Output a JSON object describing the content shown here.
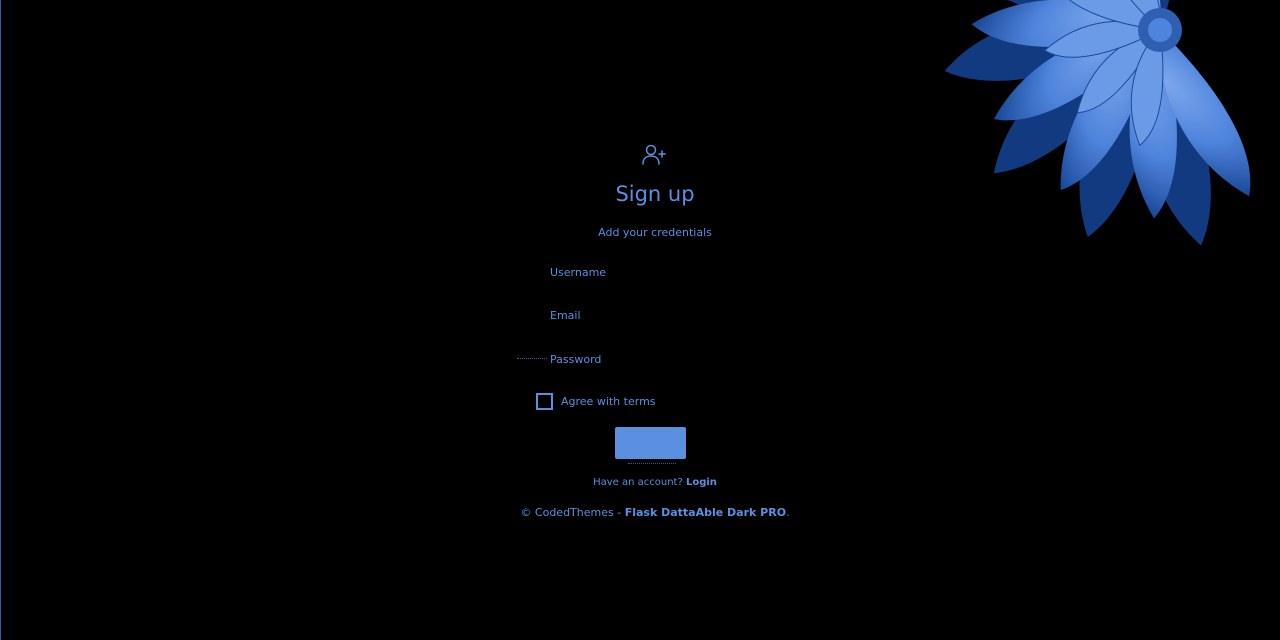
{
  "colors": {
    "background": "#000000",
    "accent": "#5b8fe0",
    "flower_light": "#5b8fe0",
    "flower_dark": "#123a80"
  },
  "header": {
    "icon": "user-plus-icon",
    "title": "Sign up",
    "subtitle": "Add your credentials"
  },
  "form": {
    "username_placeholder": "Username",
    "username_value": "",
    "email_placeholder": "Email",
    "email_value": "",
    "password_placeholder": "Password",
    "password_value": "",
    "agree_label": "Agree with terms",
    "agree_checked": false,
    "submit_label": ""
  },
  "login_prompt": {
    "text": "Have an account?",
    "link": "Login"
  },
  "footer": {
    "copyright": "© CodedThemes -",
    "brand": "Flask DattaAble Dark PRO",
    "end": "."
  }
}
